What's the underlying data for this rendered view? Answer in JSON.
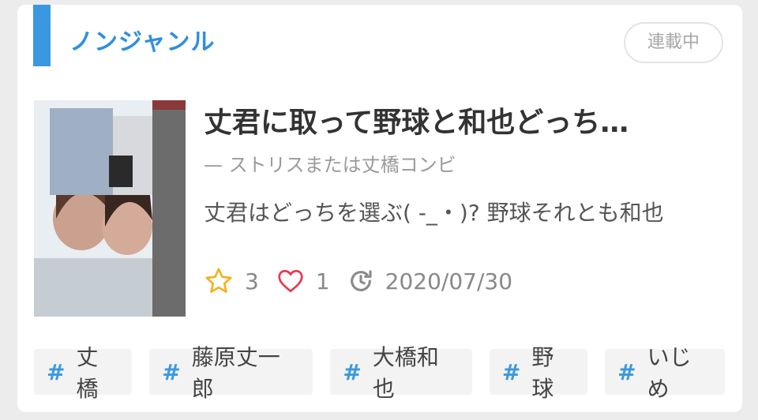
{
  "genre": "ノンジャンル",
  "status": "連載中",
  "story": {
    "title": "丈君に取って野球と和也どっち…",
    "author": "— ストリスまたは丈橋コンビ",
    "description": "丈君はどっちを選ぶ( -_・)? 野球それとも和也",
    "stars": "3",
    "likes": "1",
    "updated": "2020/07/30"
  },
  "tags": [
    "丈橋",
    "藤原丈一郎",
    "大橋和也",
    "野球",
    "いじめ"
  ],
  "tag_prefix": "#",
  "icons": {
    "star": "star-icon",
    "heart": "heart-icon",
    "updated": "history-icon"
  },
  "colors": {
    "accent": "#3a98e0",
    "star": "#f2b31e",
    "heart": "#e8384f",
    "text_dark": "#333333",
    "text_muted": "#888888"
  }
}
